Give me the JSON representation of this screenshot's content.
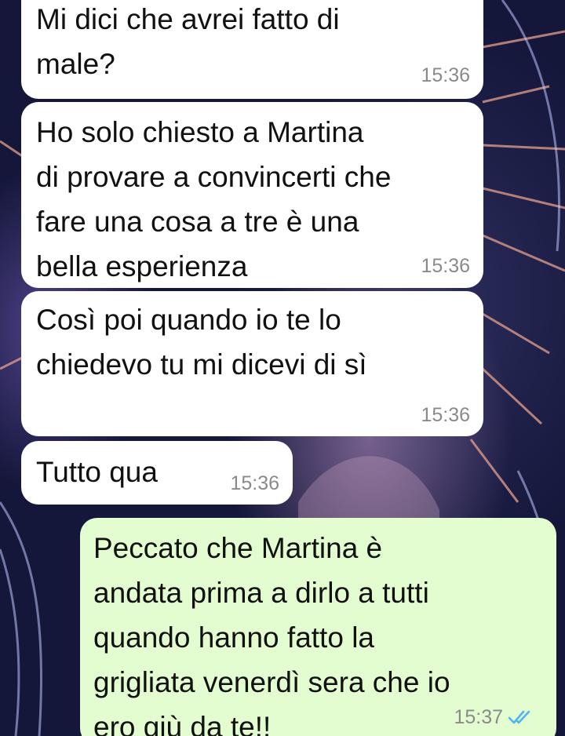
{
  "messages": [
    {
      "direction": "incoming",
      "text": "Mi dici che avrei fatto di\nmale?",
      "time": "15:36"
    },
    {
      "direction": "incoming",
      "text": "Ho solo chiesto a Martina\ndi provare a convincerti che\nfare una cosa a tre è una\nbella esperienza",
      "time": "15:36"
    },
    {
      "direction": "incoming",
      "text": "Così poi quando io te lo\nchiedevo tu mi dicevi di sì",
      "time": "15:36"
    },
    {
      "direction": "incoming",
      "text": "Tutto qua",
      "time": "15:36"
    },
    {
      "direction": "outgoing",
      "text": "Peccato che Martina è\nandata prima a dirlo a tutti\nquando hanno fatto la\ngrigliata venerdì sera che io\nero giù da te!!",
      "time": "15:37",
      "status": "read-double-check"
    }
  ],
  "colors": {
    "incoming_bubble": "#ffffff",
    "outgoing_bubble": "#e3fdd1",
    "timestamp": "#8a8a8a",
    "read_ticks": "#4fb6ec"
  },
  "icons": [
    "double-check-read-icon"
  ]
}
